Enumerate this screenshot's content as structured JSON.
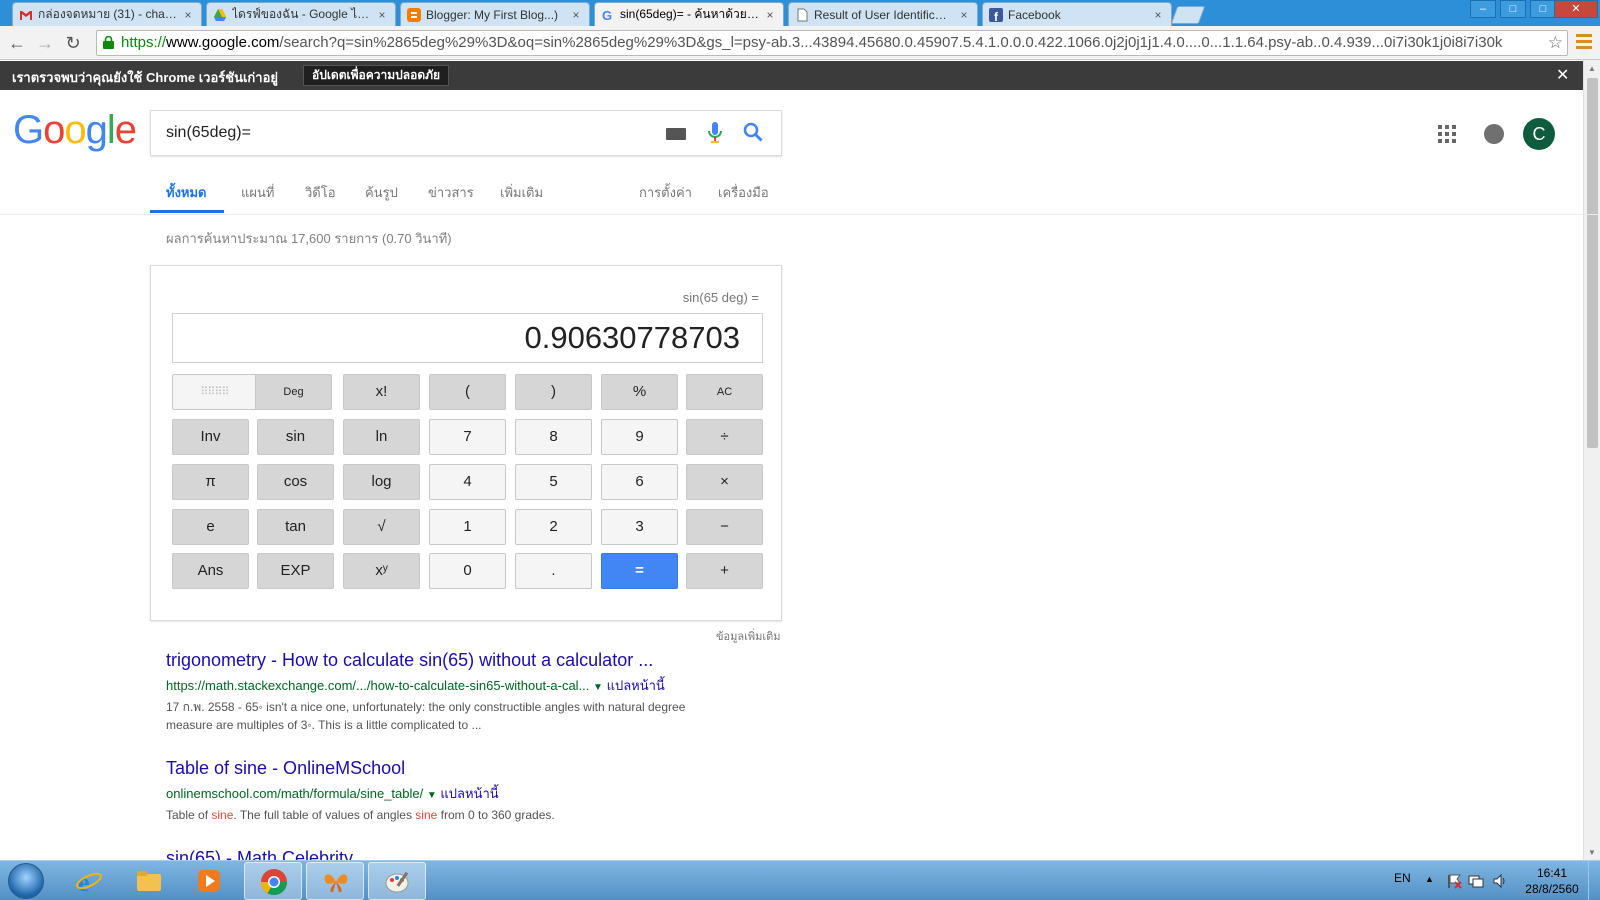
{
  "browser": {
    "tabs": [
      {
        "title": "กล่องจดหมาย (31) - chayan",
        "icon": "gmail-icon"
      },
      {
        "title": "ไดรฟ์ของฉัน - Google ไดรฟ์",
        "icon": "drive-icon"
      },
      {
        "title": "Blogger: My First Blog...)",
        "icon": "blogger-icon"
      },
      {
        "title": "sin(65deg)= - ค้นหาด้วย Google",
        "icon": "google-icon",
        "active": true
      },
      {
        "title": "Result of User Identificatio",
        "icon": "page-icon"
      },
      {
        "title": "Facebook",
        "icon": "facebook-icon"
      }
    ],
    "tab_close": "×",
    "window_controls": {
      "minimize": "–",
      "maximize": "□",
      "close": "✕"
    },
    "nav": {
      "back": "←",
      "forward": "→",
      "reload": "↻"
    },
    "url": {
      "scheme": "https://",
      "host": "www.google.com",
      "rest": "/search?q=sin%2865deg%29%3D&oq=sin%2865deg%29%3D&gs_l=psy-ab.3...43894.45680.0.45907.5.4.1.0.0.0.422.1066.0j2j0j1j1.4.0....0...1.1.64.psy-ab..0.4.939...0i7i30k1j0i8i7i30k"
    },
    "bookmark_star": "☆",
    "infobar": {
      "message": "เราตรวจพบว่าคุณยังใช้ Chrome เวอร์ชันเก่าอยู่",
      "button": "อัปเดตเพื่อความปลอดภัย",
      "close": "✕"
    }
  },
  "google": {
    "logo_letters": [
      {
        "ch": "G",
        "color": "#4285F4"
      },
      {
        "ch": "o",
        "color": "#EA4335"
      },
      {
        "ch": "o",
        "color": "#FBBC05"
      },
      {
        "ch": "g",
        "color": "#4285F4"
      },
      {
        "ch": "l",
        "color": "#34A853"
      },
      {
        "ch": "e",
        "color": "#EA4335"
      }
    ],
    "query": "sin(65deg)=",
    "avatar_letter": "C",
    "tabs": [
      "ทั้งหมด",
      "แผนที่",
      "วิดีโอ",
      "ค้นรูป",
      "ข่าวสาร",
      "เพิ่มเติม"
    ],
    "settings": "การตั้งค่า",
    "tools": "เครื่องมือ",
    "result_stats": "ผลการค้นหาประมาณ 17,600 รายการ (0.70 วินาที)"
  },
  "calculator": {
    "expression": "sin(65 deg) =",
    "result": "0.90630778703",
    "rad_label": "Rad",
    "deg_label": "Deg",
    "rows": [
      [
        "x!",
        "(",
        ")",
        "%",
        "AC"
      ],
      [
        "Inv",
        "sin",
        "ln",
        "7",
        "8",
        "9",
        "÷"
      ],
      [
        "π",
        "cos",
        "log",
        "4",
        "5",
        "6",
        "×"
      ],
      [
        "e",
        "tan",
        "√",
        "1",
        "2",
        "3",
        "−"
      ],
      [
        "Ans",
        "EXP",
        "xʸ",
        "0",
        ".",
        "=",
        "+"
      ]
    ],
    "more_info": "ข้อมูลเพิ่มเติม"
  },
  "results": [
    {
      "title": "trigonometry - How to calculate sin(65) without a calculator ...",
      "url": "https://math.stackexchange.com/.../how-to-calculate-sin65-without-a-cal...",
      "translate": "แปลหน้านี้",
      "snippet": [
        "17 ก.พ. 2558 - 65◦ isn't a nice one, unfortunately: the only constructible angles with natural degree",
        "measure are multiples of 3◦. This is a little complicated to ..."
      ]
    },
    {
      "title": "Table of sine - OnlineMSchool",
      "url": "onlinemschool.com/math/formula/sine_table/",
      "translate": "แปลหน้านี้",
      "snippet_parts": [
        "Table of ",
        "sine",
        ". The full table of values of angles ",
        "sine",
        " from 0 to 360 grades."
      ]
    },
    {
      "title": "sin(65) - Math Celebrity"
    }
  ],
  "taskbar": {
    "language": "EN",
    "time": "16:41",
    "date": "28/8/2560"
  }
}
